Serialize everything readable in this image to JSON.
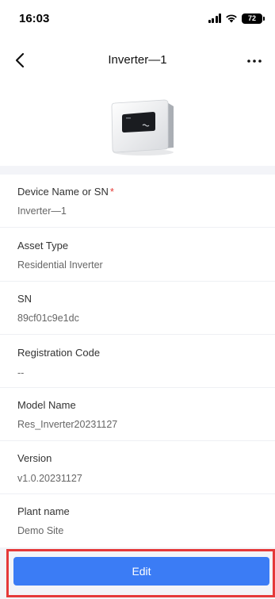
{
  "status_bar": {
    "time": "16:03",
    "battery": "72"
  },
  "nav": {
    "title": "Inverter—1",
    "back_icon": "chevron-left-icon",
    "more_icon": "more-horizontal-icon"
  },
  "device": {
    "image_icon": "inverter-device-image"
  },
  "fields": [
    {
      "label": "Device Name or SN",
      "required": "*",
      "value": "Inverter—1"
    },
    {
      "label": "Asset Type",
      "value": "Residential Inverter"
    },
    {
      "label": "SN",
      "value": "89cf01c9e1dc"
    },
    {
      "label": "Registration Code",
      "value": "--"
    },
    {
      "label": "Model Name",
      "value": "Res_Inverter20231127"
    },
    {
      "label": "Version",
      "value": "v1.0.20231127"
    },
    {
      "label": "Plant name",
      "value": "Demo Site"
    }
  ],
  "actions": {
    "edit_label": "Edit"
  },
  "colors": {
    "accent": "#3b7cf5",
    "required": "#e53935",
    "highlight": "#e53939",
    "band": "#f3f4f8"
  }
}
